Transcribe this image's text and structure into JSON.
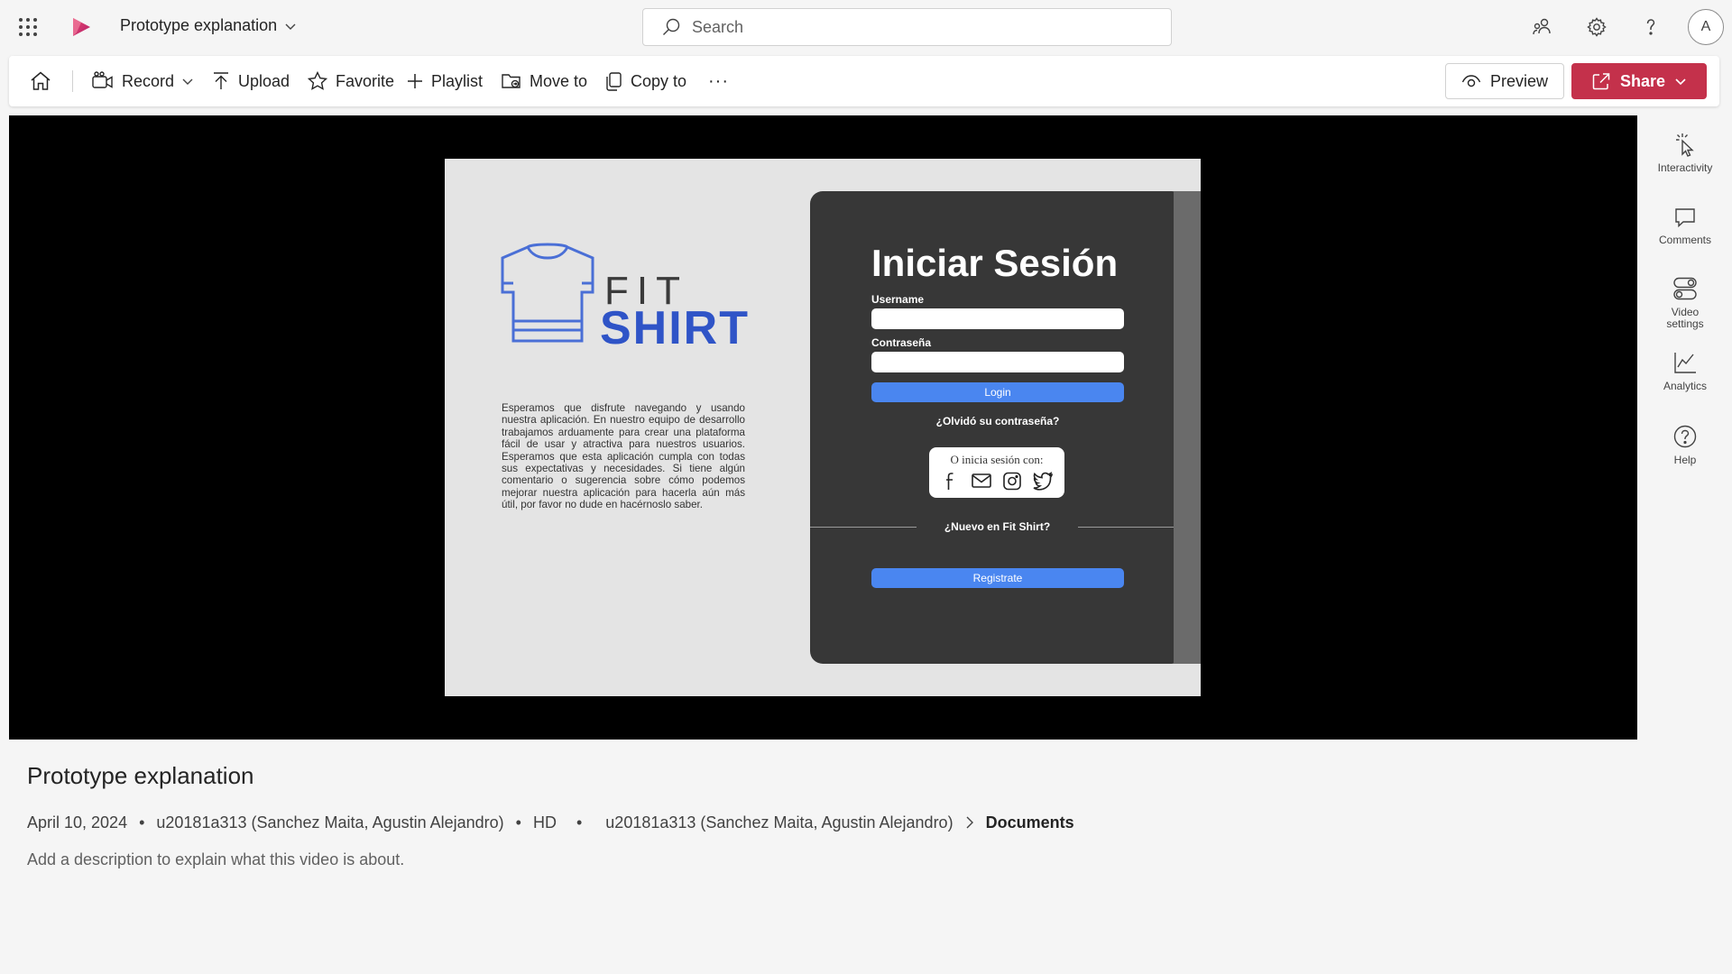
{
  "app": {
    "title": "Prototype explanation",
    "brand_color": "#c4314b",
    "accent_blue": "#4a86f0"
  },
  "search": {
    "placeholder": "Search"
  },
  "user": {
    "initial": "A"
  },
  "toolbar": {
    "record": "Record",
    "upload": "Upload",
    "favorite": "Favorite",
    "playlist": "Playlist",
    "move_to": "Move to",
    "copy_to": "Copy to",
    "more": "···",
    "preview": "Preview",
    "share": "Share"
  },
  "video_frame": {
    "brand_top": "FIT",
    "brand_bottom": "SHIRT",
    "paragraph": "Esperamos que disfrute navegando y usando nuestra aplicación. En nuestro equipo de desarrollo trabajamos arduamente para crear una plataforma fácil de usar y atractiva para nuestros usuarios. Esperamos que esta aplicación cumpla con todas sus expectativas y necesidades. Si tiene algún comentario o sugerencia sobre cómo podemos mejorar nuestra aplicación para hacerla aún más útil, por favor no dude en hacérnoslo saber.",
    "login_title": "Iniciar Sesión",
    "username_label": "Username",
    "password_label": "Contraseña",
    "login_button": "Login",
    "forgot": "¿Olvidó su contraseña?",
    "social_title": "O inicia sesión con:",
    "new_user": "¿Nuevo en Fit Shirt?",
    "register_button": "Registrate"
  },
  "side_rail": {
    "interactivity": "Interactivity",
    "comments": "Comments",
    "video_settings_1": "Video",
    "video_settings_2": "settings",
    "analytics": "Analytics",
    "help": "Help"
  },
  "details": {
    "title": "Prototype explanation",
    "date": "April 10, 2024",
    "owner": "u20181a313 (Sanchez Maita, Agustin Alejandro)",
    "quality": "HD",
    "location_owner": "u20181a313 (Sanchez Maita, Agustin Alejandro)",
    "location_folder": "Documents",
    "description_placeholder": "Add a description to explain what this video is about."
  }
}
